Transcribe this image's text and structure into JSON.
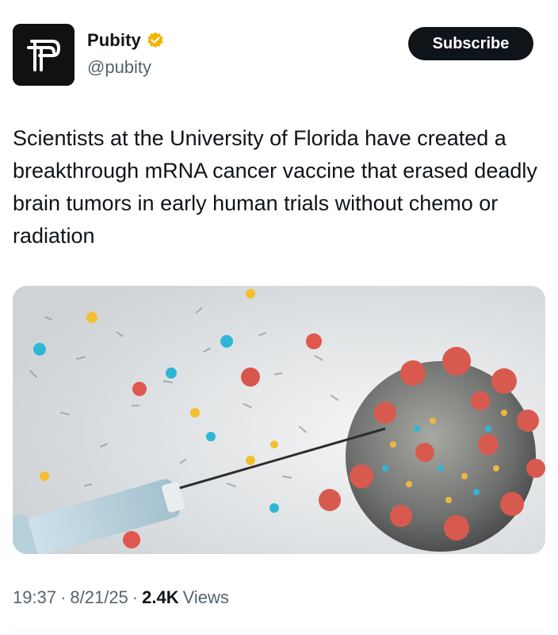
{
  "author": {
    "display_name": "Pubity",
    "handle": "@pubity",
    "avatar_icon": "pubity-logo-icon",
    "verified_icon": "verified-badge-icon",
    "verified_color": "#f4b400"
  },
  "actions": {
    "subscribe_label": "Subscribe"
  },
  "tweet": {
    "text": "Scientists at the University of Florida have created a breakthrough mRNA cancer vaccine that erased deadly brain tumors in early human trials without chemo or radiation",
    "media_icon": "syringe-virus-image"
  },
  "meta": {
    "time": "19:37",
    "sep1": "·",
    "date": "8/21/25",
    "sep2": "·",
    "views_count": "2.4K",
    "views_label": "Views"
  },
  "colors": {
    "text_primary": "#0f1419",
    "text_secondary": "#536471",
    "button_bg": "#0f1419"
  }
}
